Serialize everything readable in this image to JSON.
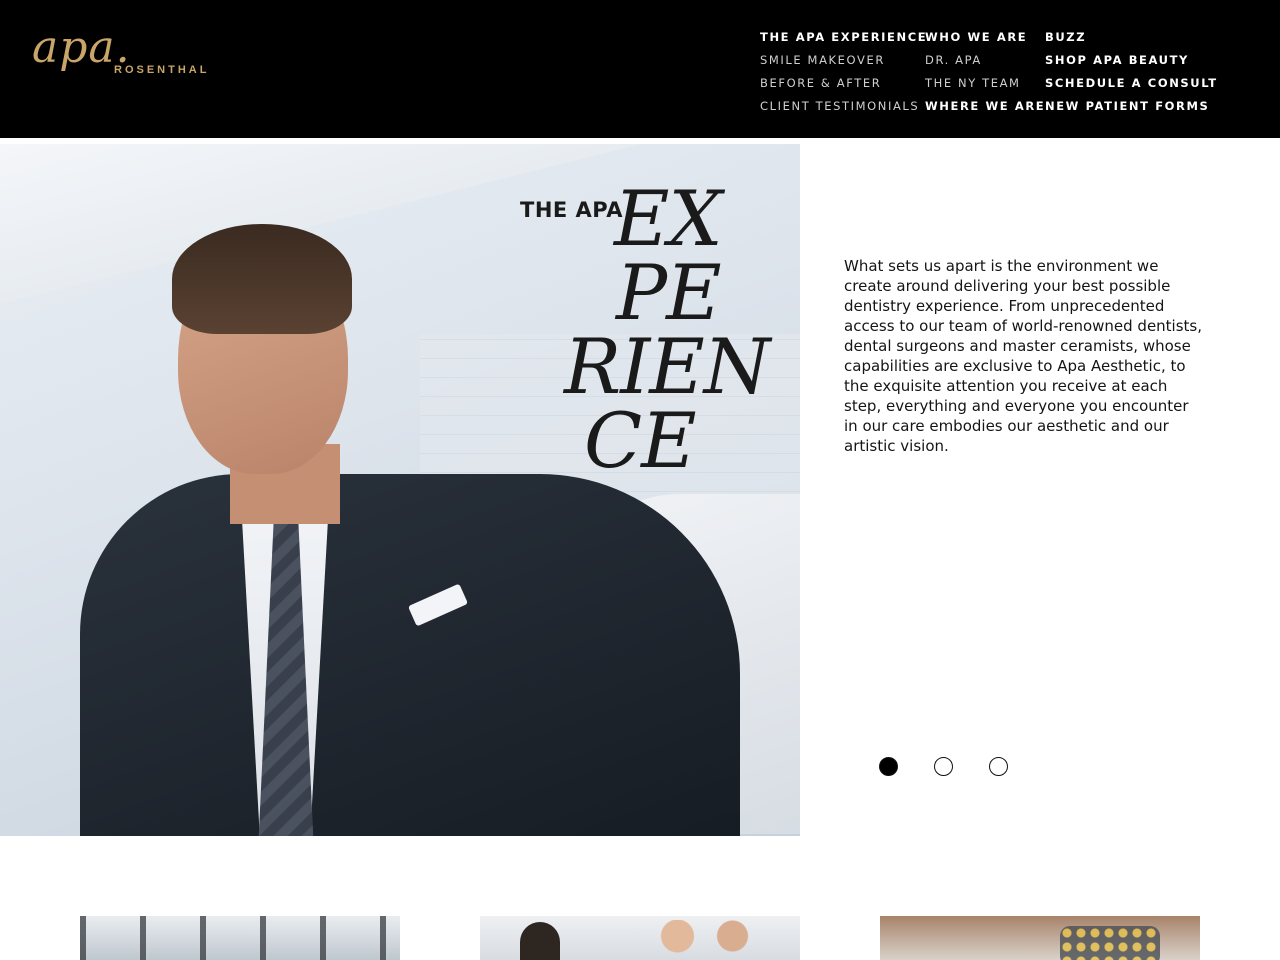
{
  "logo": {
    "script": "apa.",
    "sub": "ROSENTHAL"
  },
  "nav": {
    "col1": [
      "THE APA EXPERIENCE",
      "SMILE MAKEOVER",
      "BEFORE & AFTER",
      "CLIENT TESTIMONIALS"
    ],
    "col2": [
      "WHO WE ARE",
      "DR. APA",
      "THE NY TEAM",
      "WHERE WE ARE"
    ],
    "col3": [
      "BUZZ",
      "SHOP APA BEAUTY",
      "SCHEDULE A CONSULT",
      "NEW PATIENT FORMS"
    ]
  },
  "hero": {
    "title_small": "THE APA",
    "title_lines": [
      "EX",
      "PE",
      "RIEN",
      "CE"
    ]
  },
  "copy": "What sets us apart is the environment we create around delivering your best possible dentistry experience. From unprecedented access to our team of world-renowned dentists, dental surgeons and master ceramists, whose capabilities are exclusive to Apa Aesthetic, to the exquisite attention you receive at each step, everything and everyone you encounter in our care embodies our aesthetic and our artistic vision.",
  "slider": {
    "count": 3,
    "active_index": 0
  },
  "colors": {
    "header_bg": "#000000",
    "logo_gold": "#c9a56a"
  }
}
